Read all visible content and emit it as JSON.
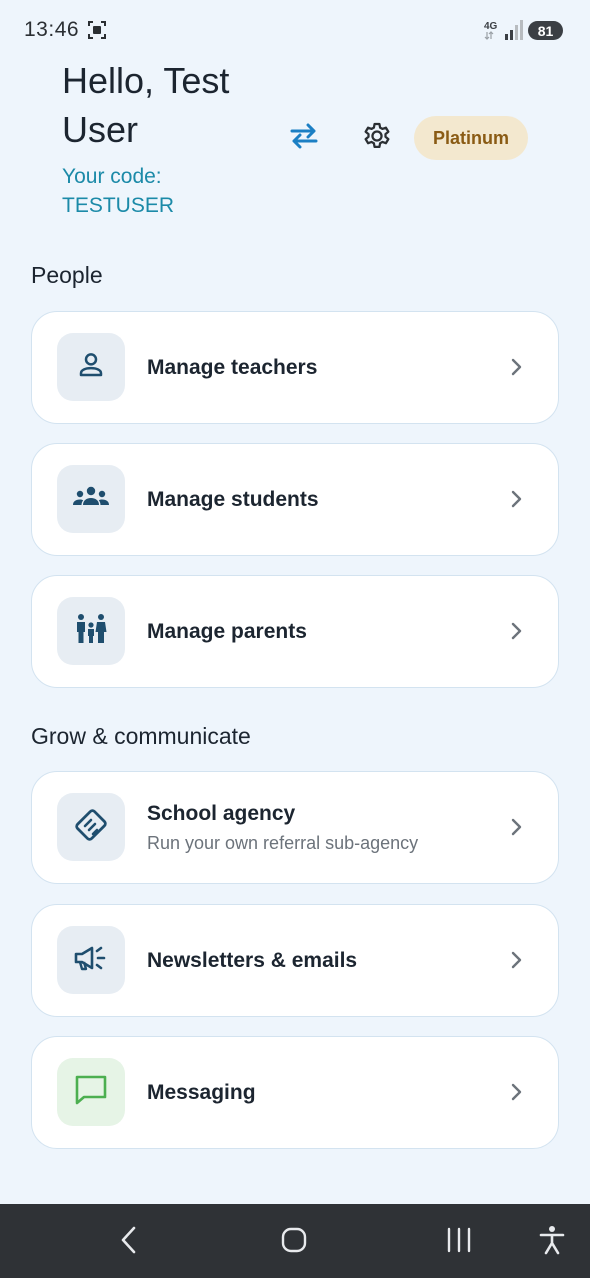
{
  "status_bar": {
    "time": "13:46",
    "network": "4G",
    "battery": "81",
    "icons": [
      "screen-record-icon",
      "signal-icon",
      "battery-icon"
    ]
  },
  "header": {
    "greeting": "Hello, Test User",
    "code_label": "Your code:",
    "code_value": "TESTUSER",
    "plan_badge": "Platinum",
    "icons": [
      "swap-icon",
      "gear-icon"
    ]
  },
  "sections": {
    "people": {
      "title": "People",
      "items": [
        {
          "label": "Manage teachers",
          "icon": "person-icon"
        },
        {
          "label": "Manage students",
          "icon": "group-icon"
        },
        {
          "label": "Manage parents",
          "icon": "family-icon"
        }
      ]
    },
    "grow": {
      "title": "Grow & communicate",
      "items": [
        {
          "label": "School agency",
          "sublabel": "Run your own referral sub-agency",
          "icon": "handshake-icon"
        },
        {
          "label": "Newsletters & emails",
          "icon": "megaphone-icon"
        },
        {
          "label": "Messaging",
          "icon": "chat-icon"
        }
      ]
    }
  },
  "colors": {
    "background": "#eef5fc",
    "accent": "#1b8aa8",
    "icon_blue": "#1f4e6e",
    "badge_bg": "#f3e8cf",
    "badge_text": "#8a5b14",
    "messaging_green": "#4caf50",
    "nav_bar": "#2f3236"
  },
  "nav_bar": {
    "icons": [
      "back-icon",
      "home-icon",
      "recents-icon",
      "accessibility-icon"
    ]
  }
}
